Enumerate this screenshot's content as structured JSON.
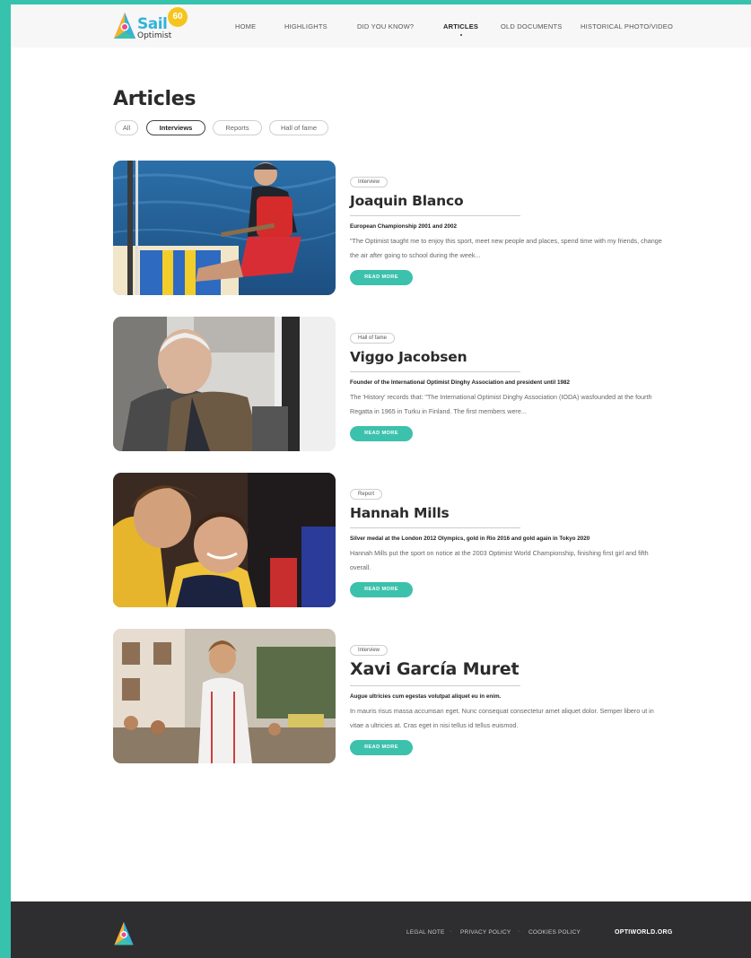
{
  "header": {
    "logo": {
      "name": "Sail",
      "sub": "Optimist",
      "badge": "60"
    },
    "nav": [
      {
        "label": "HOME"
      },
      {
        "label": "HIGHLIGHTS"
      },
      {
        "label": "DID YOU KNOW?"
      },
      {
        "label": "ARTICLES",
        "active": true
      },
      {
        "label": "OLD DOCUMENTS"
      },
      {
        "label": "HISTORICAL PHOTO/VIDEO"
      }
    ]
  },
  "main": {
    "title": "Articles",
    "filters": [
      {
        "label": "All"
      },
      {
        "label": "Interviews",
        "active": true
      },
      {
        "label": "Reports"
      },
      {
        "label": "Hall of fame"
      }
    ],
    "articles": [
      {
        "tag": "Interview",
        "title": "Joaquin Blanco",
        "subtitle": "European Championship 2001 and 2002",
        "excerpt": "\"The Optimist taught me to enjoy this sport, meet new people and places, spend time with my friends, change the air after going to school during the week...",
        "button": "READ MORE"
      },
      {
        "tag": "Hall of fame",
        "title": "Viggo Jacobsen",
        "subtitle": "Founder of the International Optimist Dinghy Association and president until 1982",
        "excerpt": "The 'History' records that: \"The International Optimist Dinghy Association (IODA) wasfounded at the fourth Regatta in 1965 in Turku in Finland. The first members were...",
        "button": "READ MORE"
      },
      {
        "tag": "Report",
        "title": "Hannah Mills",
        "subtitle": "Silver medal at the London 2012 Olympics, gold in Rio 2016 and gold again in Tokyo 2020",
        "excerpt": "Hannah Mills put the sport on notice at the 2003 Optimist World Championship, finishing first girl and fifth overall.",
        "button": "READ MORE"
      },
      {
        "tag": "Interview",
        "title": "Xavi García Muret",
        "subtitle": "Augue ultricies cum egestas volutpat aliquet eu in enim.",
        "excerpt": "In mauris risus massa accumsan eget. Nunc consequat consectetur amet aliquet dolor. Semper libero ut in vitae a ultricies at. Cras eget in nisi tellus id tellus euismod.",
        "button": "READ MORE"
      }
    ]
  },
  "footer": {
    "links": [
      {
        "label": "LEGAL NOTE"
      },
      {
        "label": "PRIVACY POLICY"
      },
      {
        "label": "COOKIES POLICY"
      }
    ],
    "site": "OPTIWORLD.ORG"
  },
  "colors": {
    "accent": "#3cc1ac",
    "frame": "#36c2ad",
    "footer_bg": "#2e2e30",
    "logo_badge": "#f5c51d"
  }
}
